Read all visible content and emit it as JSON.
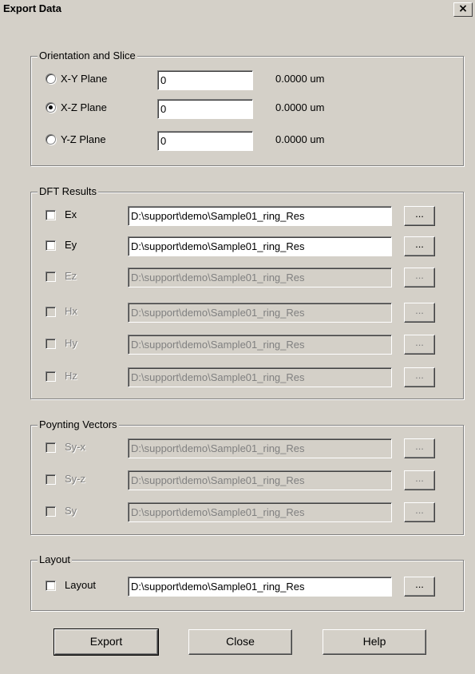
{
  "window": {
    "title": "Export Data",
    "close_glyph": "×"
  },
  "orientation": {
    "legend": "Orientation and Slice",
    "rows": [
      {
        "label": "X-Y Plane",
        "value": "0",
        "readout": "0.0000 um",
        "selected": false
      },
      {
        "label": "X-Z Plane",
        "value": "0",
        "readout": "0.0000 um",
        "selected": true
      },
      {
        "label": "Y-Z Plane",
        "value": "0",
        "readout": "0.0000 um",
        "selected": false
      }
    ]
  },
  "dft": {
    "legend": "DFT Results",
    "rows": [
      {
        "label": "Ex",
        "path": "D:\\support\\demo\\Sample01_ring_Res",
        "browse": "...",
        "enabled": true
      },
      {
        "label": "Ey",
        "path": "D:\\support\\demo\\Sample01_ring_Res",
        "browse": "...",
        "enabled": true
      },
      {
        "label": "Ez",
        "path": "D:\\support\\demo\\Sample01_ring_Res",
        "browse": "...",
        "enabled": false
      },
      {
        "label": "Hx",
        "path": "D:\\support\\demo\\Sample01_ring_Res",
        "browse": "...",
        "enabled": false
      },
      {
        "label": "Hy",
        "path": "D:\\support\\demo\\Sample01_ring_Res",
        "browse": "...",
        "enabled": false
      },
      {
        "label": "Hz",
        "path": "D:\\support\\demo\\Sample01_ring_Res",
        "browse": "...",
        "enabled": false
      }
    ]
  },
  "poynting": {
    "legend": "Poynting Vectors",
    "rows": [
      {
        "label": "Sy-x",
        "path": "D:\\support\\demo\\Sample01_ring_Res",
        "browse": "...",
        "enabled": false
      },
      {
        "label": "Sy-z",
        "path": "D:\\support\\demo\\Sample01_ring_Res",
        "browse": "...",
        "enabled": false
      },
      {
        "label": "Sy",
        "path": "D:\\support\\demo\\Sample01_ring_Res",
        "browse": "...",
        "enabled": false
      }
    ]
  },
  "layout": {
    "legend": "Layout",
    "label": "Layout",
    "path": "D:\\support\\demo\\Sample01_ring_Res",
    "browse": "..."
  },
  "buttons": {
    "export": "Export",
    "close": "Close",
    "help": "Help"
  }
}
